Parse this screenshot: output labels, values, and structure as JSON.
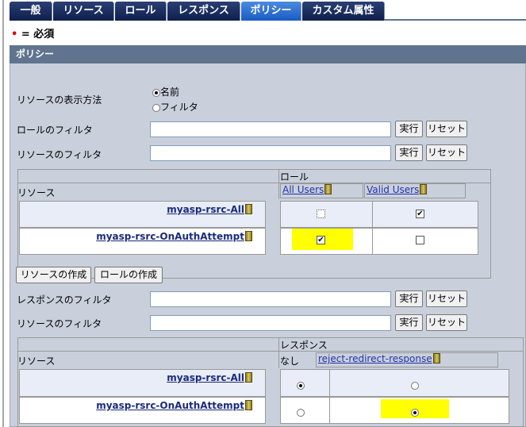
{
  "tabs": [
    "一般",
    "リソース",
    "ロール",
    "レスポンス",
    "ポリシー",
    "カスタム属性"
  ],
  "active_tab": "ポリシー",
  "required_legend": {
    "marker": "•",
    "text": "= 必須"
  },
  "panel_title": "ポリシー",
  "display_method": {
    "label": "リソースの表示方法",
    "options": [
      "名前",
      "フィルタ"
    ],
    "selected": "名前"
  },
  "role_filter": {
    "label": "ロールのフィルタ",
    "value": "",
    "run": "実行",
    "reset": "リセット"
  },
  "resource_filter1": {
    "label": "リソースのフィルタ",
    "value": "",
    "run": "実行",
    "reset": "リセット"
  },
  "role_table": {
    "group_header": "ロール",
    "resource_header": "リソース",
    "columns": [
      "All Users",
      "Valid Users"
    ],
    "rows": [
      {
        "resource": "myasp-rsrc-All",
        "checked": [
          false,
          true
        ]
      },
      {
        "resource": "myasp-rsrc-OnAuthAttempt",
        "checked": [
          true,
          false
        ]
      }
    ]
  },
  "create_resource": "リソースの作成",
  "create_role": "ロールの作成",
  "response_filter": {
    "label": "レスポンスのフィルタ",
    "value": "",
    "run": "実行",
    "reset": "リセット"
  },
  "resource_filter2": {
    "label": "リソースのフィルタ",
    "value": "",
    "run": "実行",
    "reset": "リセット"
  },
  "response_table": {
    "group_header": "レスポンス",
    "resource_header": "リソース",
    "none_label": "なし",
    "columns": [
      "reject-redirect-response"
    ],
    "rows": [
      {
        "resource": "myasp-rsrc-All",
        "selected": "なし"
      },
      {
        "resource": "myasp-rsrc-OnAuthAttempt",
        "selected": "reject-redirect-response"
      }
    ]
  }
}
